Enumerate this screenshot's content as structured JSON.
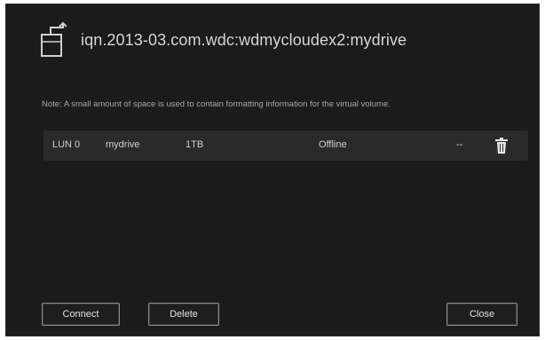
{
  "dialog": {
    "title": "iqn.2013-03.com.wdc:wdmycloudex2:mydrive",
    "note": "Note: A small amount of space is used to contain formatting information for the virtual volume.",
    "row": {
      "lun": "LUN 0",
      "name": "mydrive",
      "size": "1TB",
      "status": "Offline",
      "dash": "--"
    },
    "buttons": {
      "connect": "Connect",
      "delete": "Delete",
      "close": "Close"
    }
  },
  "colors": {
    "background": "#1b1b1b",
    "row": "#2a2a2a",
    "text": "#d6d6d6",
    "button_border": "#8c8c8c"
  },
  "icons": {
    "header": "iscsi-target-icon",
    "row_action": "trash-icon"
  }
}
